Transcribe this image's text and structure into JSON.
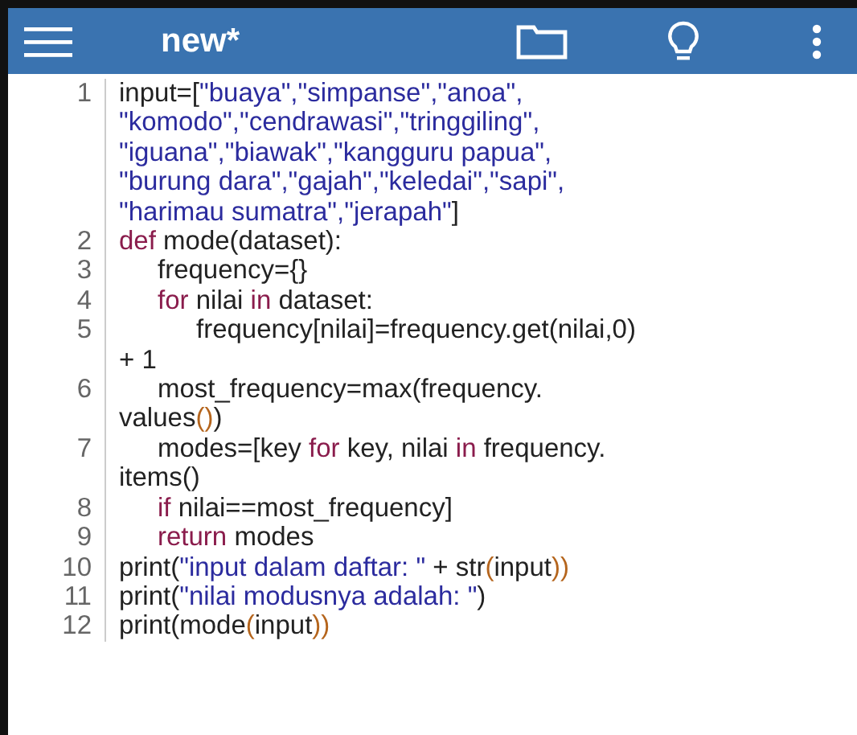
{
  "toolbar": {
    "title": "new*"
  },
  "lines": [
    {
      "number": "1",
      "rows": [
        {
          "parts": [
            {
              "text": "input=[",
              "kind": "plain"
            },
            {
              "text": "\"buaya\",\"simpanse\",\"anoa\",",
              "kind": "string"
            }
          ]
        },
        {
          "parts": [
            {
              "text": "\"komodo\",\"cendrawasi\",\"tringgiling\",",
              "kind": "string"
            }
          ]
        },
        {
          "parts": [
            {
              "text": "\"iguana\",\"biawak\",\"kangguru papua\",",
              "kind": "string"
            }
          ]
        },
        {
          "parts": [
            {
              "text": "\"burung dara\",\"gajah\",\"keledai\",\"sapi\",",
              "kind": "string"
            }
          ]
        },
        {
          "parts": [
            {
              "text": "\"harimau sumatra\",\"jerapah\"",
              "kind": "string"
            },
            {
              "text": "]",
              "kind": "plain"
            }
          ]
        }
      ]
    },
    {
      "number": "2",
      "rows": [
        {
          "parts": [
            {
              "text": "def",
              "kind": "keyword"
            },
            {
              "text": " mode(dataset):",
              "kind": "plain"
            }
          ]
        }
      ],
      "children": [
        {
          "number": "3",
          "rows": [
            {
              "parts": [
                {
                  "text": "frequency={}",
                  "kind": "plain"
                }
              ]
            }
          ]
        },
        {
          "number": "4",
          "rows": [
            {
              "parts": [
                {
                  "text": "for",
                  "kind": "keyword"
                },
                {
                  "text": " nilai ",
                  "kind": "plain"
                },
                {
                  "text": "in",
                  "kind": "keyword"
                },
                {
                  "text": " dataset:",
                  "kind": "plain"
                }
              ]
            }
          ],
          "children": [
            {
              "number": "5",
              "rows": [
                {
                  "parts": [
                    {
                      "text": "frequency[nilai]=frequency.get(nilai,0)",
                      "kind": "plain"
                    }
                  ]
                },
                {
                  "parts": [
                    {
                      "text": "+ 1",
                      "kind": "plain"
                    }
                  ]
                }
              ]
            }
          ]
        },
        {
          "number": "6",
          "rows": [
            {
              "parts": [
                {
                  "text": "most_frequency=max(frequency.",
                  "kind": "plain"
                }
              ]
            },
            {
              "parts": [
                {
                  "text": "values",
                  "kind": "plain"
                },
                {
                  "text": "()",
                  "kind": "bracket"
                },
                {
                  "text": ")",
                  "kind": "plain"
                }
              ]
            }
          ]
        },
        {
          "number": "7",
          "rows": [
            {
              "parts": [
                {
                  "text": "modes=[key ",
                  "kind": "plain"
                },
                {
                  "text": "for",
                  "kind": "keyword"
                },
                {
                  "text": " key, nilai ",
                  "kind": "plain"
                },
                {
                  "text": "in",
                  "kind": "keyword"
                },
                {
                  "text": " frequency.",
                  "kind": "plain"
                }
              ]
            },
            {
              "parts": [
                {
                  "text": "items()",
                  "kind": "plain"
                }
              ]
            }
          ]
        },
        {
          "number": "8",
          "rows": [
            {
              "parts": [
                {
                  "text": "if",
                  "kind": "keyword"
                },
                {
                  "text": " nilai==most_frequency]",
                  "kind": "plain"
                }
              ]
            }
          ]
        },
        {
          "number": "9",
          "rows": [
            {
              "parts": [
                {
                  "text": "return",
                  "kind": "keyword"
                },
                {
                  "text": " modes",
                  "kind": "plain"
                }
              ]
            }
          ]
        }
      ]
    },
    {
      "number": "10",
      "rows": [
        {
          "parts": [
            {
              "text": "print(",
              "kind": "plain"
            },
            {
              "text": "\"input dalam daftar: \"",
              "kind": "string"
            },
            {
              "text": " + str",
              "kind": "plain"
            },
            {
              "text": "(",
              "kind": "bracket"
            },
            {
              "text": "input",
              "kind": "plain"
            },
            {
              "text": "))",
              "kind": "bracket"
            }
          ]
        }
      ]
    },
    {
      "number": "11",
      "rows": [
        {
          "parts": [
            {
              "text": "print(",
              "kind": "plain"
            },
            {
              "text": "\"nilai modusnya adalah: \"",
              "kind": "string"
            },
            {
              "text": ")",
              "kind": "plain"
            }
          ]
        }
      ]
    },
    {
      "number": "12",
      "rows": [
        {
          "parts": [
            {
              "text": "print(mode",
              "kind": "plain"
            },
            {
              "text": "(",
              "kind": "bracket"
            },
            {
              "text": "input",
              "kind": "plain"
            },
            {
              "text": "))",
              "kind": "bracket"
            }
          ]
        }
      ]
    }
  ]
}
